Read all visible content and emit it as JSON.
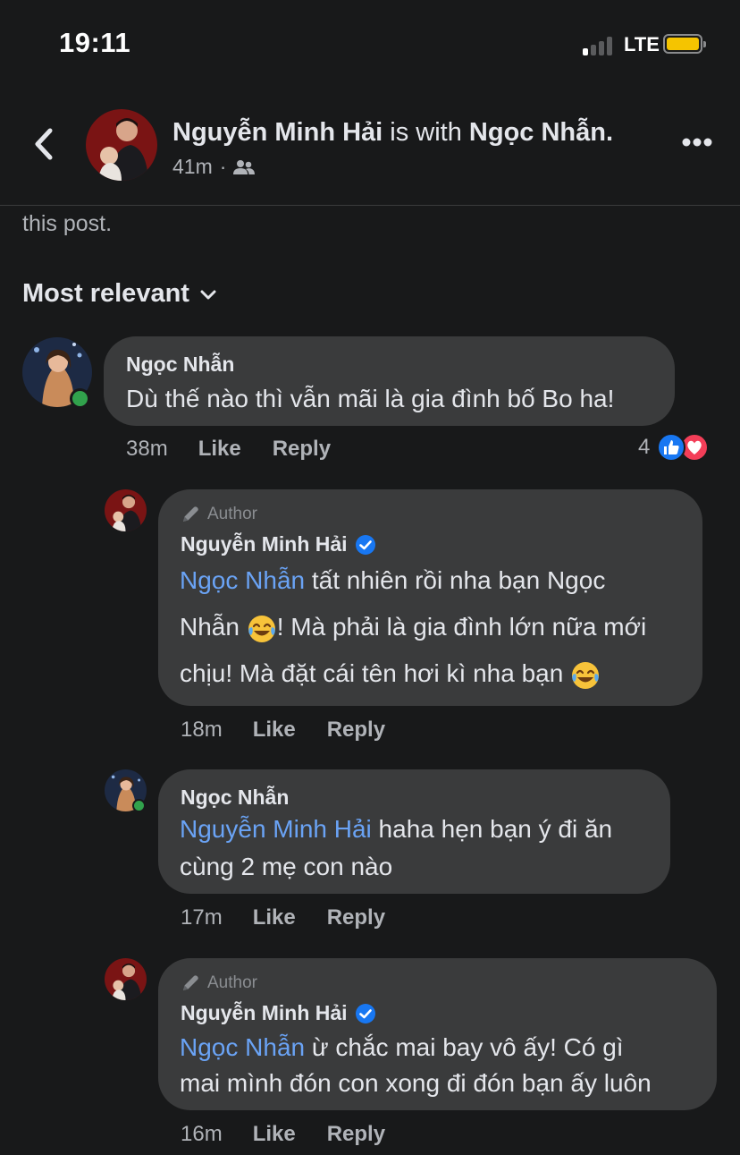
{
  "status_bar": {
    "time": "19:11",
    "network": "LTE"
  },
  "header": {
    "name": "Nguyễn Minh Hải",
    "connector": " is with ",
    "with_name": "Ngọc Nhẫn.",
    "time": "41m",
    "separator": "·",
    "audience_icon": "friends-icon"
  },
  "post_tail": "this post.",
  "sort": {
    "label": "Most relevant"
  },
  "colors": {
    "background": "#18191a",
    "bubble": "#3a3b3c",
    "mention": "#6aa3f5",
    "online": "#31a24c",
    "like": "#1877f2",
    "love": "#f33e58",
    "verified": "#1877f2"
  },
  "comments": [
    {
      "author": "Ngọc Nhẫn",
      "text": "Dù thế nào thì vẫn mãi là gia đình bố Bo ha!",
      "time": "38m",
      "like": "Like",
      "reply": "Reply",
      "reaction_count": "4"
    },
    {
      "badge": "Author",
      "author": "Nguyễn Minh Hải",
      "mention": "Ngọc Nhẫn",
      "line1": " tất nhiên rồi nha bạn Ngọc",
      "line2a": "Nhẫn ",
      "line2b": "! Mà phải là gia đình lớn nữa mới",
      "line3": "chịu! Mà đặt cái tên hơi kì nha bạn ",
      "time": "18m",
      "like": "Like",
      "reply": "Reply"
    },
    {
      "author": "Ngọc Nhẫn",
      "mention": "Nguyễn Minh Hải",
      "line1": " haha hẹn bạn ý đi ăn",
      "line2": "cùng 2 mẹ con nào",
      "time": "17m",
      "like": "Like",
      "reply": "Reply"
    },
    {
      "badge": "Author",
      "author": "Nguyễn Minh Hải",
      "mention": "Ngọc Nhẫn",
      "line1": " ừ chắc mai bay vô ấy! Có gì",
      "line2": "mai mình đón con xong đi đón bạn ấy luôn",
      "time": "16m",
      "like": "Like",
      "reply": "Reply"
    }
  ]
}
